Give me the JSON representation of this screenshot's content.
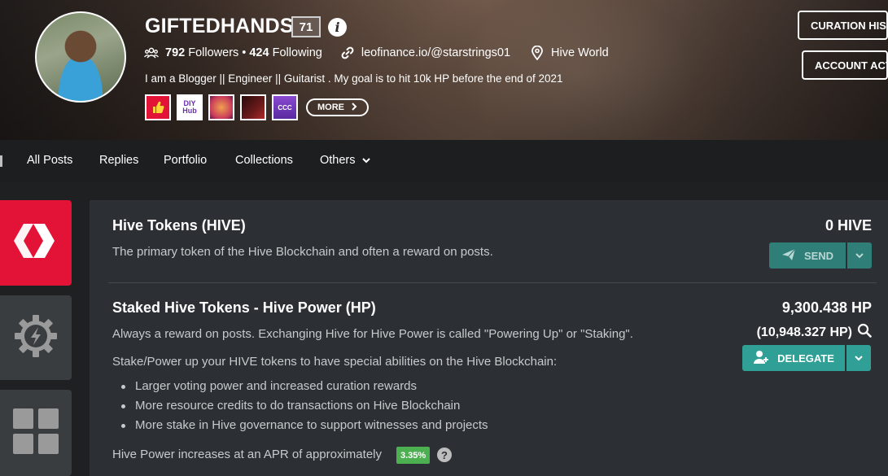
{
  "profile": {
    "username": "GIFTEDHANDS",
    "reputation": "71",
    "followers_count": "792",
    "followers_label": "Followers",
    "separator": "•",
    "following_count": "424",
    "following_label": "Following",
    "website": "leofinance.io/@starstrings01",
    "location": "Hive World",
    "bio": "I am a Blogger || Engineer || Guitarist . My goal is to hit 10k HP before the end of 2021",
    "badges": [
      {
        "icon": "thumbs-up-badge",
        "color": "#e31337"
      },
      {
        "icon": "diy-hub-badge",
        "text": "DIY Hub",
        "color": "#ffffff"
      },
      {
        "icon": "strings-badge",
        "color": "#d84a4a"
      },
      {
        "icon": "guitar-badge",
        "color": "#3a1010"
      },
      {
        "icon": "ccc-badge",
        "text": "CCC",
        "color": "#6a3ab0"
      }
    ],
    "more_label": "MORE",
    "curation_button": "CURATION HIST",
    "account_button": "ACCOUNT ACT"
  },
  "nav": {
    "tabs": [
      "All Posts",
      "Replies",
      "Portfolio",
      "Collections",
      "Others"
    ]
  },
  "wallet": {
    "hive": {
      "title": "Hive Tokens (HIVE)",
      "description": "The primary token of the Hive Blockchain and often a reward on posts.",
      "amount": "0 HIVE",
      "button": "SEND"
    },
    "hp": {
      "title": "Staked Hive Tokens - Hive Power (HP)",
      "description": "Always a reward on posts. Exchanging Hive for Hive Power is called \"Powering Up\" or \"Staking\".",
      "description2": "Stake/Power up your HIVE tokens to have special abilities on the Hive Blockchain:",
      "bullets": [
        "Larger voting power and increased curation rewards",
        "More resource credits to do transactions on Hive Blockchain",
        "More stake in Hive governance to support witnesses and projects"
      ],
      "apr_text": "Hive Power increases at an APR of approximately",
      "apr_value": "3.35%",
      "amount": "9,300.438 HP",
      "effective_amount": "(10,948.327 HP)",
      "button": "DELEGATE"
    }
  },
  "colors": {
    "hive_red": "#e31337",
    "teal": "#30a096",
    "apr_green": "#4caf50",
    "panel": "#2c3034"
  }
}
